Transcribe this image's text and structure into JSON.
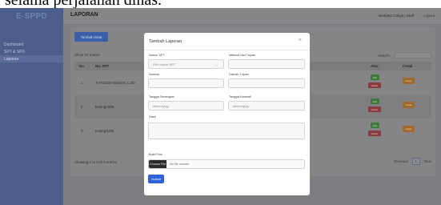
{
  "caption": "selama perjalanan dinas.",
  "sidebar": {
    "brand": "E-SPPD",
    "items": [
      {
        "label": "Dashboard"
      },
      {
        "label": "SPT & SPD"
      },
      {
        "label": "Laporan"
      }
    ]
  },
  "topbar": {
    "title": "LAPORAN",
    "user": "Berkana Cahya | Staff",
    "logout": "Logout"
  },
  "page": {
    "add_button": "Tambah Data",
    "show_label": "Show  10  entries",
    "search_label": "Search:",
    "table": {
      "headers": [
        "No",
        "No. SPT",
        "Aksi",
        "Cetak"
      ],
      "rows": [
        {
          "no": "1",
          "spt": "TUTO/100 DDDOK 1.3/0"
        },
        {
          "no": "2",
          "spt": "testing/2/09"
        },
        {
          "no": "3",
          "spt": "testing/1/09"
        }
      ],
      "edit_label": "Edit",
      "delete_label": "Delete",
      "print_label": "Cetak"
    },
    "info": "Showing 1 to 3 of 3 entries",
    "pager": {
      "prev": "Previous",
      "current": "1",
      "next": "Next"
    }
  },
  "modal": {
    "title": "Tambah Laporan",
    "close": "×",
    "fields": {
      "nomor_spt": {
        "label": "Nomor SPT",
        "value": "Pilih Nomor SPT"
      },
      "maksud": {
        "label": "Maksud dan Tujuan",
        "value": ""
      },
      "selama": {
        "label": "Selama",
        "value": ""
      },
      "daerah": {
        "label": "Daerah Tujuan",
        "value": ""
      },
      "tgl_berangkat": {
        "label": "Tanggal Berangkat",
        "value": "dd/mm/yyyy"
      },
      "tgl_kembali": {
        "label": "Tanggal Kembali",
        "value": "dd/mm/yyyy"
      },
      "hasil": {
        "label": "Hasil",
        "value": ""
      },
      "bukti": {
        "label": "Bukti Foto",
        "button": "Choose File",
        "status": "No file chosen"
      }
    },
    "submit": "Submit"
  }
}
